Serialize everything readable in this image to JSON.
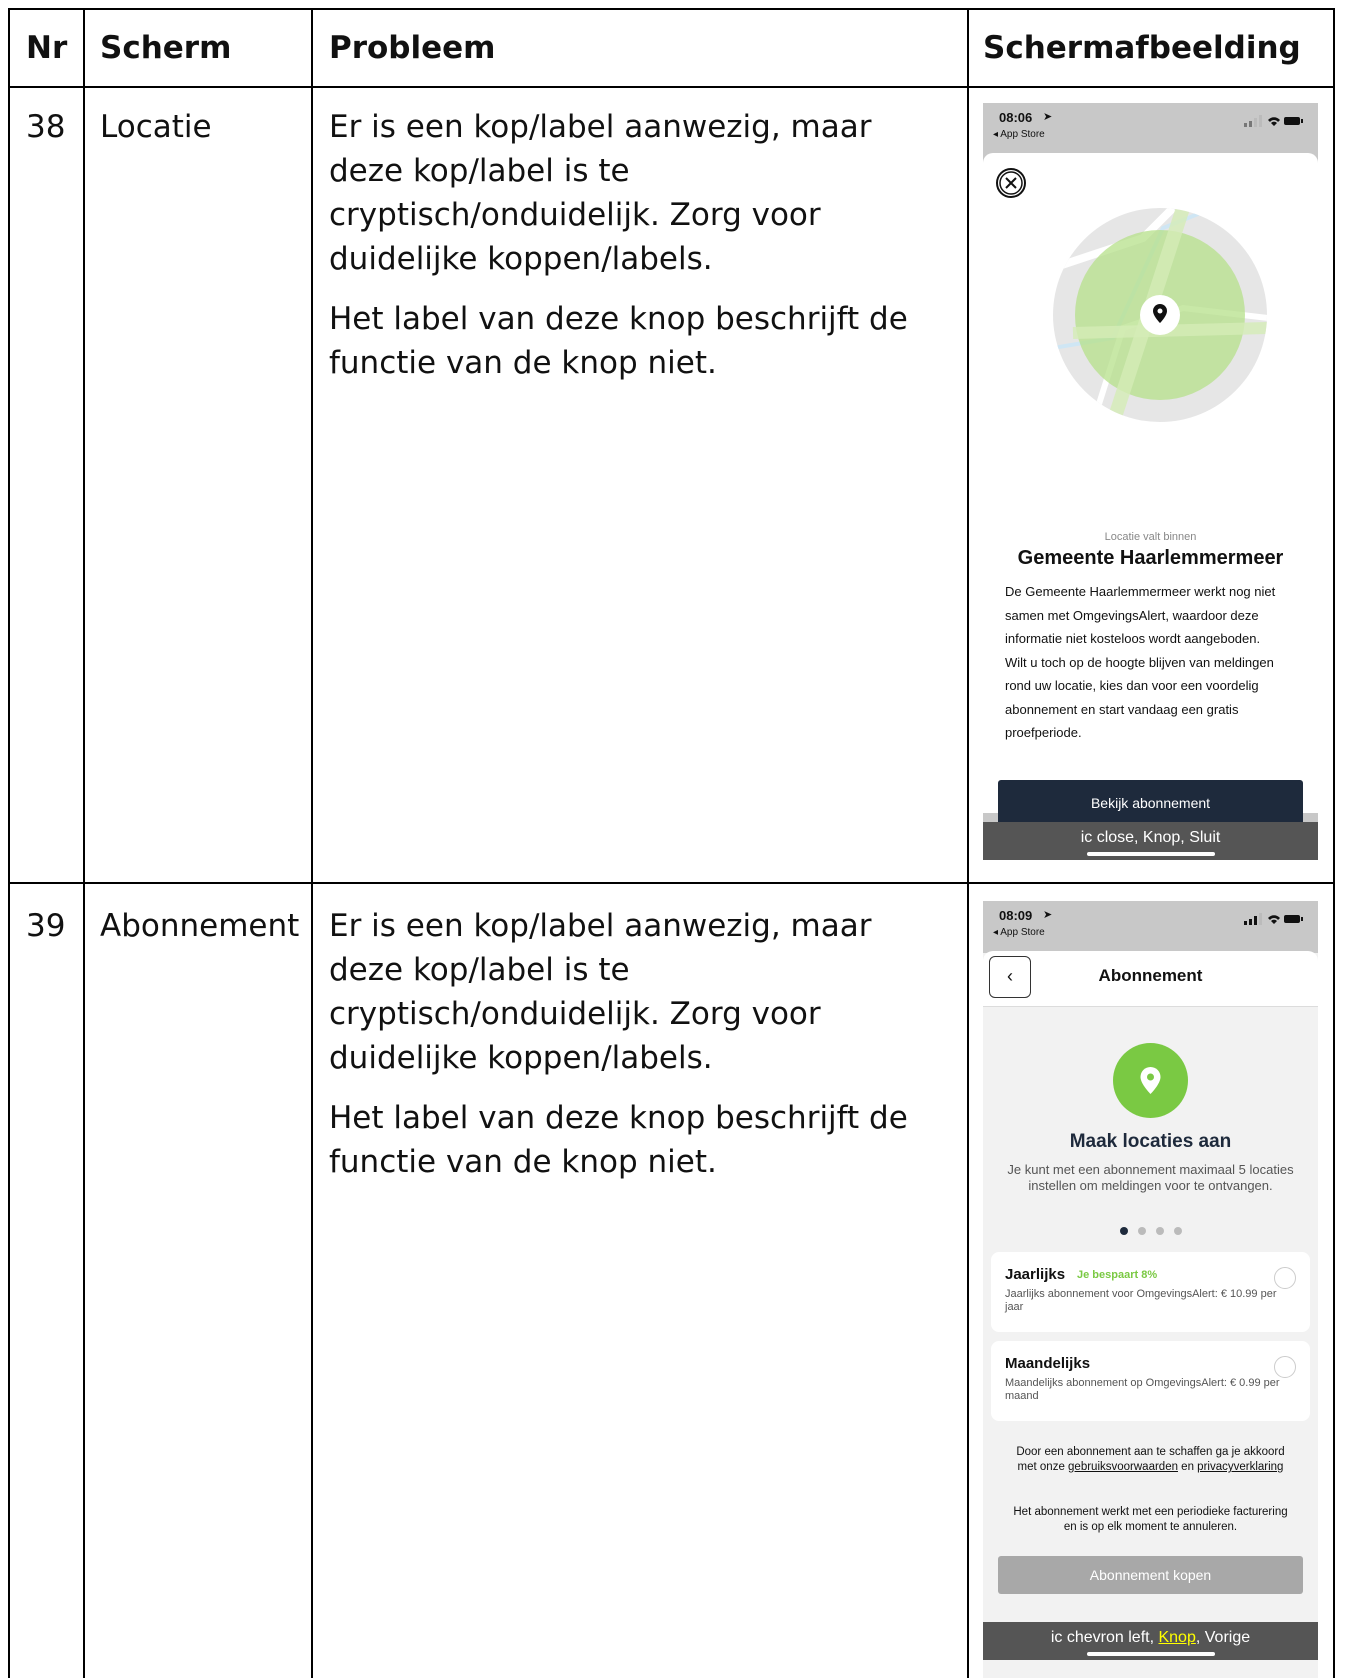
{
  "table": {
    "headers": {
      "nr": "Nr",
      "scherm": "Scherm",
      "probleem": "Probleem",
      "schermafbeelding": "Schermafbeelding"
    },
    "rows": [
      {
        "nr": "38",
        "scherm": "Locatie",
        "probleem_p1": "Er is een kop/label aanwezig, maar deze kop/label is te cryptisch/onduidelijk. Zorg voor duidelijke koppen/labels.",
        "probleem_p2": "Het label van deze knop beschrijft de functie van de knop niet.",
        "screenshot": {
          "time": "08:06",
          "back": "◂ App Store",
          "subtitle": "Locatie valt binnen",
          "title": "Gemeente Haarlemmermeer",
          "body": "De Gemeente Haarlemmermeer werkt nog niet samen met OmgevingsAlert, waardoor deze informatie niet kosteloos wordt aangeboden. Wilt u toch op de hoogte blijven van meldingen rond uw locatie, kies dan voor een voordelig abonnement en start vandaag een gratis proefperiode.",
          "button": "Bekijk abonnement",
          "caption": "ic close, Knop, Sluit"
        }
      },
      {
        "nr": "39",
        "scherm": "Abonnement",
        "probleem_p1": "Er is een kop/label aanwezig, maar deze kop/label is te cryptisch/onduidelijk. Zorg voor duidelijke koppen/labels.",
        "probleem_p2": "Het label van deze knop beschrijft de functie van de knop niet.",
        "screenshot": {
          "time": "08:09",
          "back": "◂ App Store",
          "nav_title": "Abonnement",
          "heading": "Maak locaties aan",
          "intro": "Je kunt met een abonnement maximaal 5 locaties instellen om meldingen voor te ontvangen.",
          "option1_title": "Jaarlijks",
          "option1_badge": "Je bespaart 8%",
          "option1_desc": "Jaarlijks abonnement voor OmgevingsAlert: € 10.99 per jaar",
          "option2_title": "Maandelijks",
          "option2_desc": "Maandelijks abonnement op OmgevingsAlert: € 0.99 per maand",
          "terms_pre": "Door een abonnement aan te schaffen ga je akkoord met onze ",
          "terms_link1": "gebruiksvoorwaarden",
          "terms_mid": " en ",
          "terms_link2": "privacyverklaring",
          "billing": "Het abonnement werkt met een periodieke facturering en is op elk moment te annuleren.",
          "button": "Abonnement kopen",
          "caption_pre": "ic chevron left, ",
          "caption_highlight": "Knop",
          "caption_post": ", Vorige"
        }
      }
    ]
  },
  "colors": {
    "navy": "#1e2a3c",
    "green": "#7ac943",
    "caption_bg": "#555555",
    "highlight": "#ffff00"
  }
}
